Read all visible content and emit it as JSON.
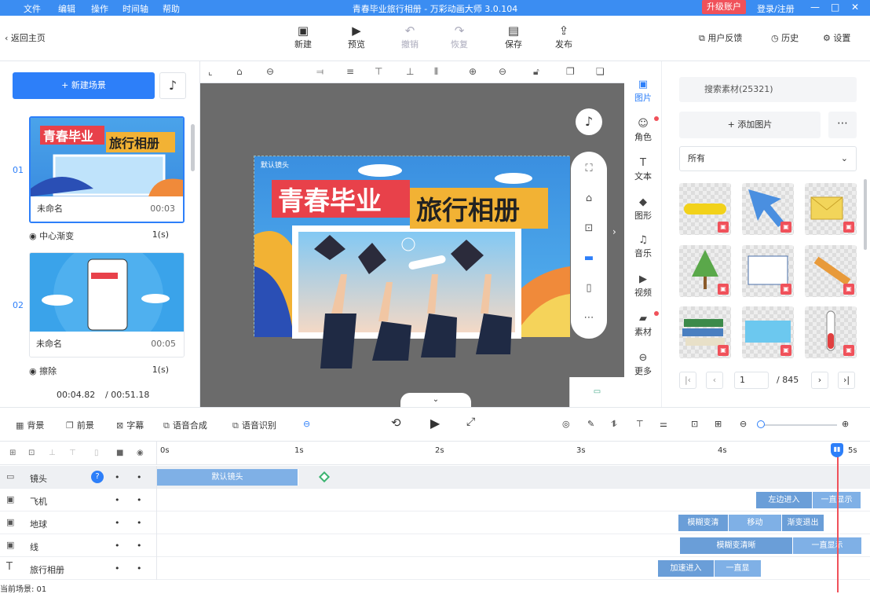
{
  "menu": [
    "文件",
    "编辑",
    "操作",
    "时间轴",
    "帮助"
  ],
  "window_title": "青春毕业旅行相册 - 万彩动画大师 3.0.104",
  "upgrade_label": "升级账户",
  "login_label": "登录/注册",
  "toolbar": {
    "back_label": "返回主页",
    "new_label": "新建",
    "preview_label": "预览",
    "undo_label": "撤销",
    "redo_label": "恢复",
    "save_label": "保存",
    "publish_label": "发布",
    "feedback_label": "用户反馈",
    "history_label": "历史",
    "settings_label": "设置"
  },
  "scenes": {
    "new_scene_label": "+ 新建场景",
    "items": [
      {
        "num": "01",
        "name": "未命名",
        "duration": "00:03",
        "transition": "中心渐变",
        "transition_dur": "1(s)"
      },
      {
        "num": "02",
        "name": "未命名",
        "duration": "00:05",
        "transition": "擦除",
        "transition_dur": "1(s)"
      }
    ],
    "time_current": "00:04.82",
    "time_total": "/ 00:51.18"
  },
  "stage": {
    "title_part1": "青春毕业",
    "title_part2": "旅行相册",
    "camera_label": "默认镜头"
  },
  "side_tabs": [
    "图片",
    "角色",
    "文本",
    "图形",
    "音乐",
    "视频",
    "素材",
    "更多"
  ],
  "asset": {
    "search_placeholder": "搜索素材(25321)",
    "add_label": "+ 添加图片",
    "filter_value": "所有",
    "page": "1",
    "page_total": "/ 845"
  },
  "tl_toolbar": [
    "背景",
    "前景",
    "字幕",
    "语音合成",
    "语音识别"
  ],
  "ruler": [
    "0s",
    "1s",
    "2s",
    "3s",
    "4s",
    "5s"
  ],
  "tracks": [
    {
      "icon": "camera-icon",
      "glyph": "▭",
      "name": "镜头",
      "clips": [
        {
          "label": "默认镜头"
        }
      ]
    },
    {
      "icon": "image-icon",
      "glyph": "▣",
      "name": "飞机",
      "clips": [
        {
          "label": "左边进入"
        },
        {
          "label": "一直显示"
        }
      ]
    },
    {
      "icon": "image-icon",
      "glyph": "▣",
      "name": "地球",
      "clips": [
        {
          "label": "模糊变清"
        },
        {
          "label": "移动"
        },
        {
          "label": "渐变退出"
        }
      ]
    },
    {
      "icon": "image-icon",
      "glyph": "▣",
      "name": "线",
      "clips": [
        {
          "label": "模糊变清晰"
        },
        {
          "label": "一直显示"
        }
      ]
    },
    {
      "icon": "text-icon",
      "glyph": "T",
      "name": "旅行相册",
      "clips": [
        {
          "label": "加速进入"
        },
        {
          "label": "一直显"
        }
      ]
    }
  ],
  "current_scene": "当前场景: 01",
  "colors": {
    "accent": "#2d7ff9",
    "title_bar": "#3b8df2",
    "alert": "#f0515a",
    "clip": "#6a9ed8"
  }
}
